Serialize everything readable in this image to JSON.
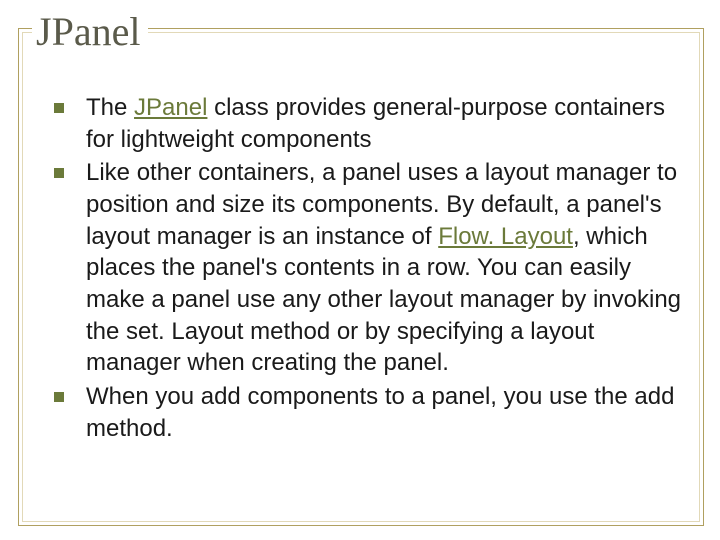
{
  "title": "JPanel",
  "bullets": [
    {
      "segments": [
        {
          "text": "The "
        },
        {
          "text": "JPanel",
          "link": true
        },
        {
          "text": " class provides general-purpose containers for lightweight components"
        }
      ]
    },
    {
      "segments": [
        {
          "text": "Like other containers, a panel uses a layout manager to position and size its components. By default, a panel's layout manager is an instance of "
        },
        {
          "text": "Flow. Layout",
          "link": true
        },
        {
          "text": ", which places the panel's contents in a row. You can easily make a panel use any other layout manager by invoking the set. Layout method or by specifying a layout manager when creating the panel."
        }
      ]
    },
    {
      "segments": [
        {
          "text": "When you add components to a panel, you use the add method."
        }
      ]
    }
  ]
}
